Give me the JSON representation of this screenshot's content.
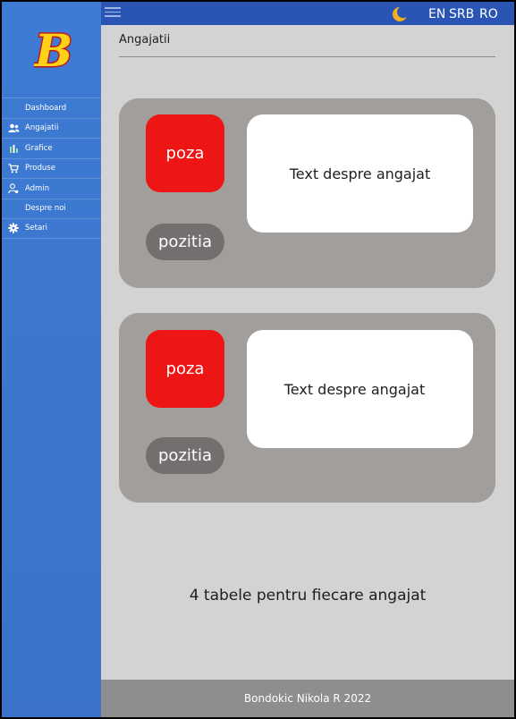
{
  "topbar": {
    "languages": [
      "EN",
      "SRB",
      "RO"
    ]
  },
  "sidebar": {
    "logo_letter": "B",
    "items": [
      {
        "label": "Dashboard",
        "icon": "none"
      },
      {
        "label": "Angajatii",
        "icon": "users-icon"
      },
      {
        "label": "Grafice",
        "icon": "bar-chart-icon"
      },
      {
        "label": "Produse",
        "icon": "cart-icon"
      },
      {
        "label": "Admin",
        "icon": "admin-icon"
      },
      {
        "label": "Despre noi",
        "icon": "none"
      },
      {
        "label": "Setari",
        "icon": "gear-icon"
      }
    ]
  },
  "main": {
    "title": "Angajatii",
    "cards": [
      {
        "photo": "poza",
        "position": "pozitia",
        "text": "Text despre angajat"
      },
      {
        "photo": "poza",
        "position": "pozitia",
        "text": "Text despre angajat"
      }
    ],
    "note": "4 tabele pentru fiecare angajat"
  },
  "footer": {
    "text": "Bondokic Nikola R 2022"
  },
  "colors": {
    "sidebar": "#3d7bd4",
    "topbar": "#2a55b5",
    "background": "#d3d3d3",
    "card": "#a29e9c",
    "photo": "#ee1515",
    "pill": "#726f6e",
    "footer": "#8e8e8e",
    "moon": "#f2b01e"
  }
}
